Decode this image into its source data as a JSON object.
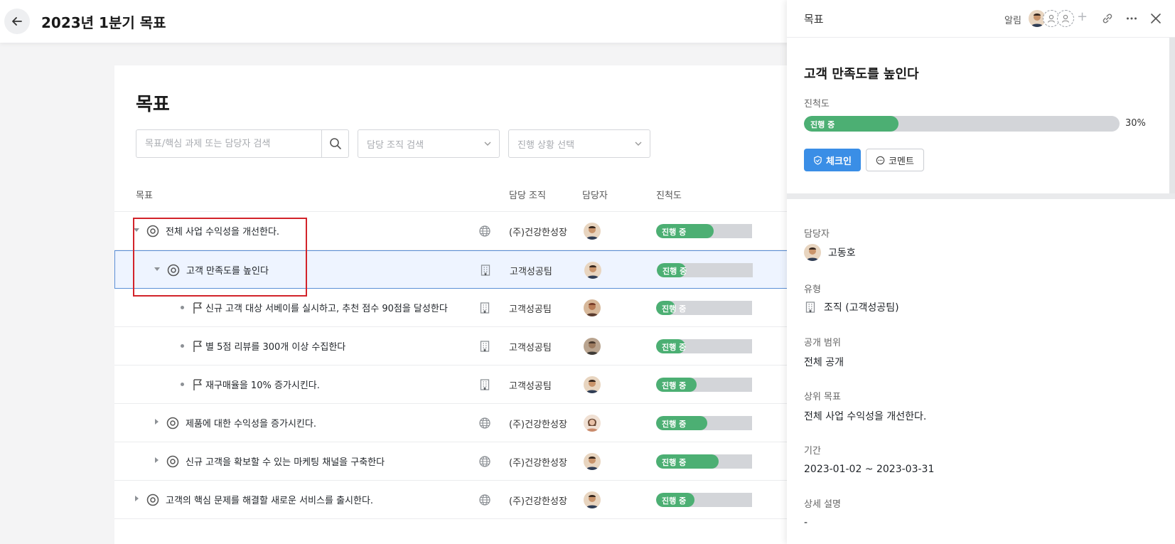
{
  "header": {
    "title": "2023년 1분기 목표"
  },
  "main": {
    "title": "목표",
    "search_placeholder": "목표/핵심 과제 또는 담당자 검색",
    "org_filter_placeholder": "담당 조직 검색",
    "status_filter_placeholder": "진행 상황 선택",
    "columns": {
      "goal": "목표",
      "org": "담당 조직",
      "owner": "담당자",
      "progress": "진척도"
    },
    "rows": [
      {
        "title": "전체 사업 수익성을 개선한다.",
        "org": "(주)건강한성장",
        "status": "진행 중",
        "progress": 0.6
      },
      {
        "title": "고객 만족도를 높인다",
        "org": "고객성공팀",
        "status": "진행 중",
        "progress": 0.3
      },
      {
        "title": "신규 고객 대상 서베이를 실시하고, 추천 점수 90점을 달성한다",
        "org": "고객성공팀",
        "status": "진행 중",
        "progress": 0.2
      },
      {
        "title": "별 5점 리뷰를 300개 이상 수집한다",
        "org": "고객성공팀",
        "status": "진행 중",
        "progress": 0.3
      },
      {
        "title": "재구매율을 10% 증가시킨다.",
        "org": "고객성공팀",
        "status": "진행 중",
        "progress": 0.42
      },
      {
        "title": "제품에 대한 수익성을 증가시킨다.",
        "org": "(주)건강한성장",
        "status": "진행 중",
        "progress": 0.53
      },
      {
        "title": "신규 고객을 확보할 수 있는 마케팅 채널을 구축한다",
        "org": "(주)건강한성장",
        "status": "진행 중",
        "progress": 0.65
      },
      {
        "title": "고객의 핵심 문제를 해결할 새로운 서비스를 출시한다.",
        "org": "(주)건강한성장",
        "status": "진행 중",
        "progress": 0.4
      }
    ]
  },
  "panel": {
    "title": "목표",
    "alarm_label": "알림",
    "plus": "+",
    "goal_title": "고객 만족도를 높인다",
    "progress_label": "진척도",
    "progress_status": "진행 중",
    "progress_value": 0.3,
    "progress_pct": "30%",
    "checkin_label": "체크인",
    "comment_label": "코멘트",
    "owner_label": "담당자",
    "owner_name": "고동호",
    "type_label": "유형",
    "type_value": "조직 (고객성공팀)",
    "visibility_label": "공개 범위",
    "visibility_value": "전체 공개",
    "parent_label": "상위 목표",
    "parent_value": "전체 사업 수익성을 개선한다.",
    "period_label": "기간",
    "period_value": "2023-01-02 ~ 2023-03-31",
    "desc_label": "상세 설명",
    "desc_value": "-"
  },
  "colors": {
    "accent": "#3a8ee6",
    "progress_green": "#4caf73",
    "highlight_red": "#d2232a"
  }
}
